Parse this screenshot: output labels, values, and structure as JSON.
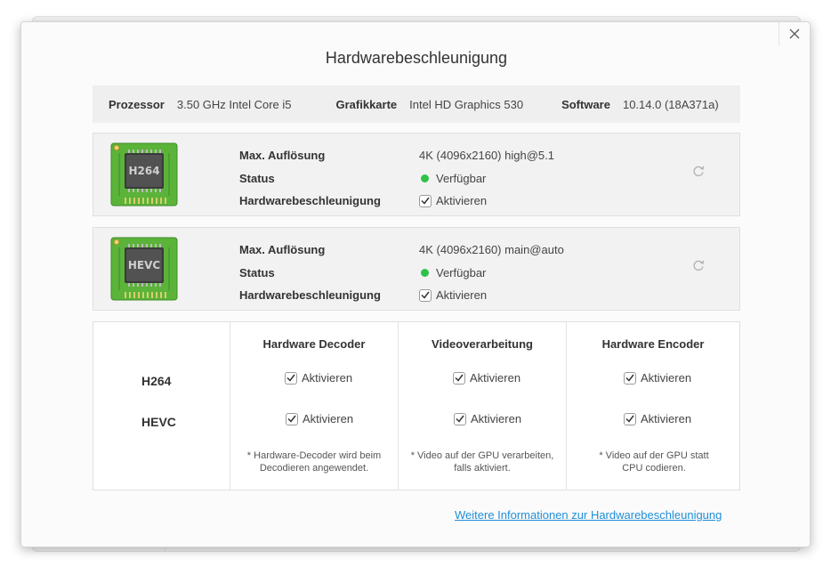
{
  "dialog": {
    "title": "Hardwarebeschleunigung",
    "close_icon": "close-icon"
  },
  "system_info": {
    "processor_label": "Prozessor",
    "processor_value": "3.50 GHz Intel Core i5",
    "graphics_label": "Grafikkarte",
    "graphics_value": "Intel HD Graphics 530",
    "software_label": "Software",
    "software_value": "10.14.0 (18A371a)"
  },
  "codecs": [
    {
      "chip_label": "H264",
      "resolution_label": "Max. Auflösung",
      "resolution_value": "4K (4096x2160) high@5.1",
      "status_label": "Status",
      "status_value": "Verfügbar",
      "status_color": "#2ec24a",
      "accel_label": "Hardwarebeschleunigung",
      "accel_checkbox_label": "Aktivieren",
      "accel_checked": true,
      "refresh_icon": "refresh-icon"
    },
    {
      "chip_label": "HEVC",
      "resolution_label": "Max. Auflösung",
      "resolution_value": "4K (4096x2160) main@auto",
      "status_label": "Status",
      "status_value": "Verfügbar",
      "status_color": "#2ec24a",
      "accel_label": "Hardwarebeschleunigung",
      "accel_checkbox_label": "Aktivieren",
      "accel_checked": true,
      "refresh_icon": "refresh-icon"
    }
  ],
  "matrix": {
    "columns": [
      {
        "header": "Hardware Decoder",
        "note": "* Hardware-Decoder wird beim Decodieren angewendet."
      },
      {
        "header": "Videoverarbeitung",
        "note": "* Video auf der GPU verarbeiten, falls aktiviert."
      },
      {
        "header": "Hardware Encoder",
        "note": "* Video auf der GPU statt CPU codieren."
      }
    ],
    "rows": [
      {
        "label": "H264",
        "cells": [
          {
            "label": "Aktivieren",
            "checked": true
          },
          {
            "label": "Aktivieren",
            "checked": true
          },
          {
            "label": "Aktivieren",
            "checked": true
          }
        ]
      },
      {
        "label": "HEVC",
        "cells": [
          {
            "label": "Aktivieren",
            "checked": true
          },
          {
            "label": "Aktivieren",
            "checked": true
          },
          {
            "label": "Aktivieren",
            "checked": true
          }
        ]
      }
    ]
  },
  "footer": {
    "link_text": "Weitere Informationen zur Hardwarebeschleunigung",
    "link_color": "#1f8ed8"
  }
}
